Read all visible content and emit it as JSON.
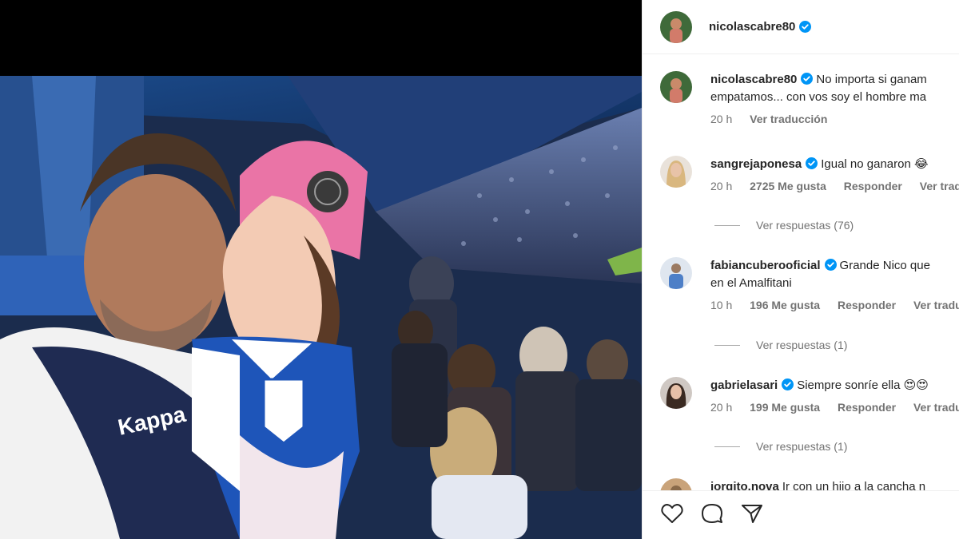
{
  "post": {
    "username": "nicolascabre80",
    "verified": true,
    "caption_user": "nicolascabre80",
    "caption_text": "No importa si ganam",
    "caption_text_line2": "empatamos... con vos soy el hombre ma",
    "caption_time": "20 h",
    "caption_translate": "Ver traducción"
  },
  "comments": [
    {
      "user": "sangrejaponesa",
      "text": "Igual no ganaron 😂",
      "time": "20 h",
      "likes": "2725 Me gusta",
      "reply": "Responder",
      "translate": "Ver tradu",
      "view_replies": "Ver respuestas (76)"
    },
    {
      "user": "fabiancuberooficial",
      "text": "Grande Nico que",
      "text_line2": "en el Amalfitani",
      "time": "10 h",
      "likes": "196 Me gusta",
      "reply": "Responder",
      "translate": "Ver traduc",
      "view_replies": "Ver respuestas (1)"
    },
    {
      "user": "gabrielasari",
      "text": "Siempre sonríe ella 😍😍",
      "time": "20 h",
      "likes": "199 Me gusta",
      "reply": "Responder",
      "translate": "Ver traduc",
      "view_replies": "Ver respuestas (1)"
    },
    {
      "user": "jorgito.nova",
      "text": "Ir con un hijo a la cancha n"
    }
  ],
  "icons": {
    "like": "heart-icon",
    "comment": "comment-icon",
    "share": "send-icon",
    "verified": "verified-badge-icon"
  },
  "colors": {
    "verified": "#0095f6",
    "secondary_text": "#737373",
    "primary_text": "#262626"
  }
}
